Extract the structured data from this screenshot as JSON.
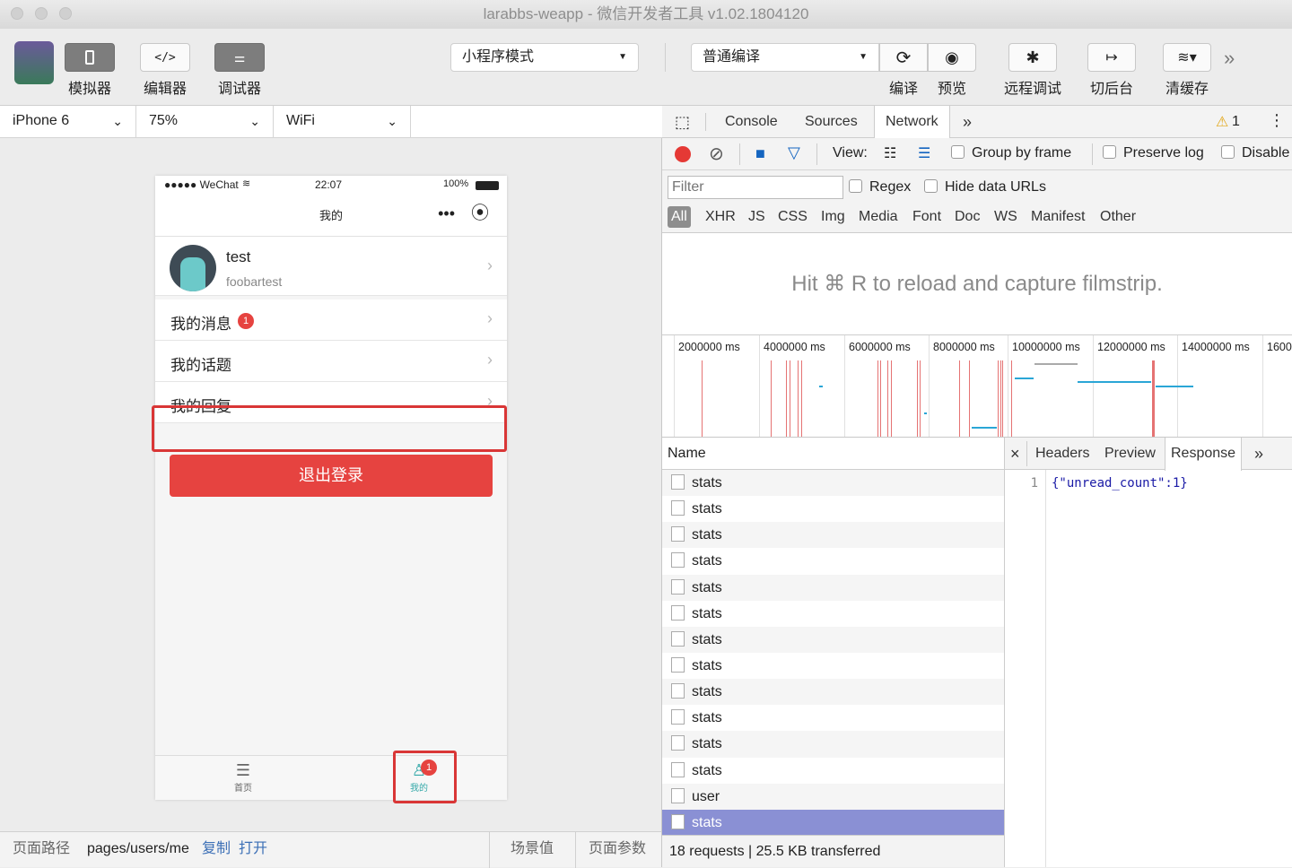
{
  "window": {
    "title": "larabbs-weapp - 微信开发者工具 v1.02.1804120"
  },
  "toolbar": {
    "simulator_label": "模拟器",
    "editor_label": "编辑器",
    "debugger_label": "调试器",
    "mode_select": "小程序模式",
    "compile_select": "普通编译",
    "compile_label": "编译",
    "preview_label": "预览",
    "remote_debug_label": "远程调试",
    "background_label": "切后台",
    "clear_cache_label": "清缓存",
    "editor_icon": "</>"
  },
  "device": {
    "model": "iPhone 6",
    "zoom": "75%",
    "network": "WiFi"
  },
  "phone": {
    "status": {
      "carrier": "●●●●● WeChat",
      "time": "22:07",
      "battery": "100%"
    },
    "nav_title": "我的",
    "user": {
      "name": "test",
      "subtitle": "foobartest"
    },
    "menu": [
      {
        "label": "我的消息",
        "badge": "1"
      },
      {
        "label": "我的话题"
      },
      {
        "label": "我的回复"
      }
    ],
    "logout_label": "退出登录",
    "tabs": [
      {
        "label": "首页"
      },
      {
        "label": "我的",
        "badge": "1"
      }
    ]
  },
  "bottombar": {
    "path_label": "页面路径",
    "path_value": "pages/users/me",
    "copy_label": "复制",
    "open_label": "打开",
    "scene_label": "场景值",
    "params_label": "页面参数"
  },
  "devtools": {
    "tabs": [
      "Console",
      "Sources",
      "Network"
    ],
    "active_tab": "Network",
    "warning_count": "1",
    "view_label": "View:",
    "group_by_frame": "Group by frame",
    "preserve_log": "Preserve log",
    "disable_cache": "Disable",
    "filter_placeholder": "Filter",
    "regex": "Regex",
    "hide_data_urls": "Hide data URLs",
    "types": [
      "All",
      "XHR",
      "JS",
      "CSS",
      "Img",
      "Media",
      "Font",
      "Doc",
      "WS",
      "Manifest",
      "Other"
    ],
    "filmstrip_hint": "Hit ⌘ R to reload and capture filmstrip.",
    "timeline_ticks": [
      "2000000 ms",
      "4000000 ms",
      "6000000 ms",
      "8000000 ms",
      "10000000 ms",
      "12000000 ms",
      "14000000 ms",
      "1600"
    ],
    "name_header": "Name",
    "requests": [
      "stats",
      "stats",
      "stats",
      "stats",
      "stats",
      "stats",
      "stats",
      "stats",
      "stats",
      "stats",
      "stats",
      "stats",
      "user",
      "stats"
    ],
    "summary": "18 requests | 25.5 KB transferred",
    "detail_tabs": [
      "Headers",
      "Preview",
      "Response"
    ],
    "active_detail_tab": "Response",
    "response_line_number": "1",
    "response_body": "{\"unread_count\":1}"
  },
  "colors": {
    "accent_red": "#e64340",
    "selected_row": "#8a90d4",
    "highlight_box": "#d93636"
  }
}
